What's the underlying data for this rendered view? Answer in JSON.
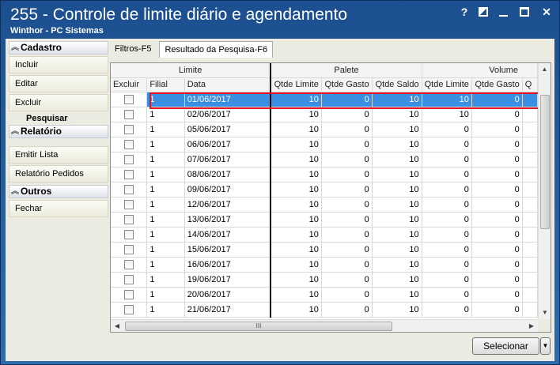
{
  "window": {
    "title": "255 - Controle de limite diário e agendamento",
    "subtitle": "Winthor - PC Sistemas"
  },
  "icons": {
    "help": "?",
    "restore": "restore-icon",
    "minimize": "minimize-icon",
    "maximize": "maximize-icon",
    "close": "✕"
  },
  "sidebar": {
    "cadastro": {
      "header": "Cadastro",
      "items": [
        "Incluir",
        "Editar",
        "Excluir"
      ],
      "sub": "Pesquisar"
    },
    "relatorio": {
      "header": "Relatório",
      "items": [
        "Emitir Lista",
        "Relatório Pedidos"
      ]
    },
    "outros": {
      "header": "Outros",
      "items": [
        "Fechar"
      ]
    }
  },
  "tabs": [
    "Filtros-F5",
    "Resultado da Pesquisa-F6"
  ],
  "grid": {
    "groups": [
      "Limite",
      "Palete",
      "Volume"
    ],
    "columns": [
      "Excluir",
      "Filial",
      "Data",
      "Qtde Limite",
      "Qtde Gasto",
      "Qtde Saldo",
      "Qtde Limite",
      "Qtde Gasto",
      "Q"
    ],
    "rows": [
      {
        "filial": "1",
        "data": "01/06/2017",
        "p_limite": "10",
        "p_gasto": "0",
        "p_saldo": "10",
        "v_limite": "10",
        "v_gasto": "0"
      },
      {
        "filial": "1",
        "data": "02/06/2017",
        "p_limite": "10",
        "p_gasto": "0",
        "p_saldo": "10",
        "v_limite": "10",
        "v_gasto": "0"
      },
      {
        "filial": "1",
        "data": "05/06/2017",
        "p_limite": "10",
        "p_gasto": "0",
        "p_saldo": "10",
        "v_limite": "0",
        "v_gasto": "0"
      },
      {
        "filial": "1",
        "data": "06/06/2017",
        "p_limite": "10",
        "p_gasto": "0",
        "p_saldo": "10",
        "v_limite": "0",
        "v_gasto": "0"
      },
      {
        "filial": "1",
        "data": "07/06/2017",
        "p_limite": "10",
        "p_gasto": "0",
        "p_saldo": "10",
        "v_limite": "0",
        "v_gasto": "0"
      },
      {
        "filial": "1",
        "data": "08/06/2017",
        "p_limite": "10",
        "p_gasto": "0",
        "p_saldo": "10",
        "v_limite": "0",
        "v_gasto": "0"
      },
      {
        "filial": "1",
        "data": "09/06/2017",
        "p_limite": "10",
        "p_gasto": "0",
        "p_saldo": "10",
        "v_limite": "0",
        "v_gasto": "0"
      },
      {
        "filial": "1",
        "data": "12/06/2017",
        "p_limite": "10",
        "p_gasto": "0",
        "p_saldo": "10",
        "v_limite": "0",
        "v_gasto": "0"
      },
      {
        "filial": "1",
        "data": "13/06/2017",
        "p_limite": "10",
        "p_gasto": "0",
        "p_saldo": "10",
        "v_limite": "0",
        "v_gasto": "0"
      },
      {
        "filial": "1",
        "data": "14/06/2017",
        "p_limite": "10",
        "p_gasto": "0",
        "p_saldo": "10",
        "v_limite": "0",
        "v_gasto": "0"
      },
      {
        "filial": "1",
        "data": "15/06/2017",
        "p_limite": "10",
        "p_gasto": "0",
        "p_saldo": "10",
        "v_limite": "0",
        "v_gasto": "0"
      },
      {
        "filial": "1",
        "data": "16/06/2017",
        "p_limite": "10",
        "p_gasto": "0",
        "p_saldo": "10",
        "v_limite": "0",
        "v_gasto": "0"
      },
      {
        "filial": "1",
        "data": "19/06/2017",
        "p_limite": "10",
        "p_gasto": "0",
        "p_saldo": "10",
        "v_limite": "0",
        "v_gasto": "0"
      },
      {
        "filial": "1",
        "data": "20/06/2017",
        "p_limite": "10",
        "p_gasto": "0",
        "p_saldo": "10",
        "v_limite": "0",
        "v_gasto": "0"
      },
      {
        "filial": "1",
        "data": "21/06/2017",
        "p_limite": "10",
        "p_gasto": "0",
        "p_saldo": "10",
        "v_limite": "0",
        "v_gasto": "0"
      }
    ],
    "selected_row": 0,
    "hscroll_grip": "III"
  },
  "footer": {
    "select_label": "Selecionar"
  },
  "colors": {
    "titlebar": "#2f6aad",
    "selection": "#3a8fe2",
    "highlight_border": "#e0121f"
  }
}
